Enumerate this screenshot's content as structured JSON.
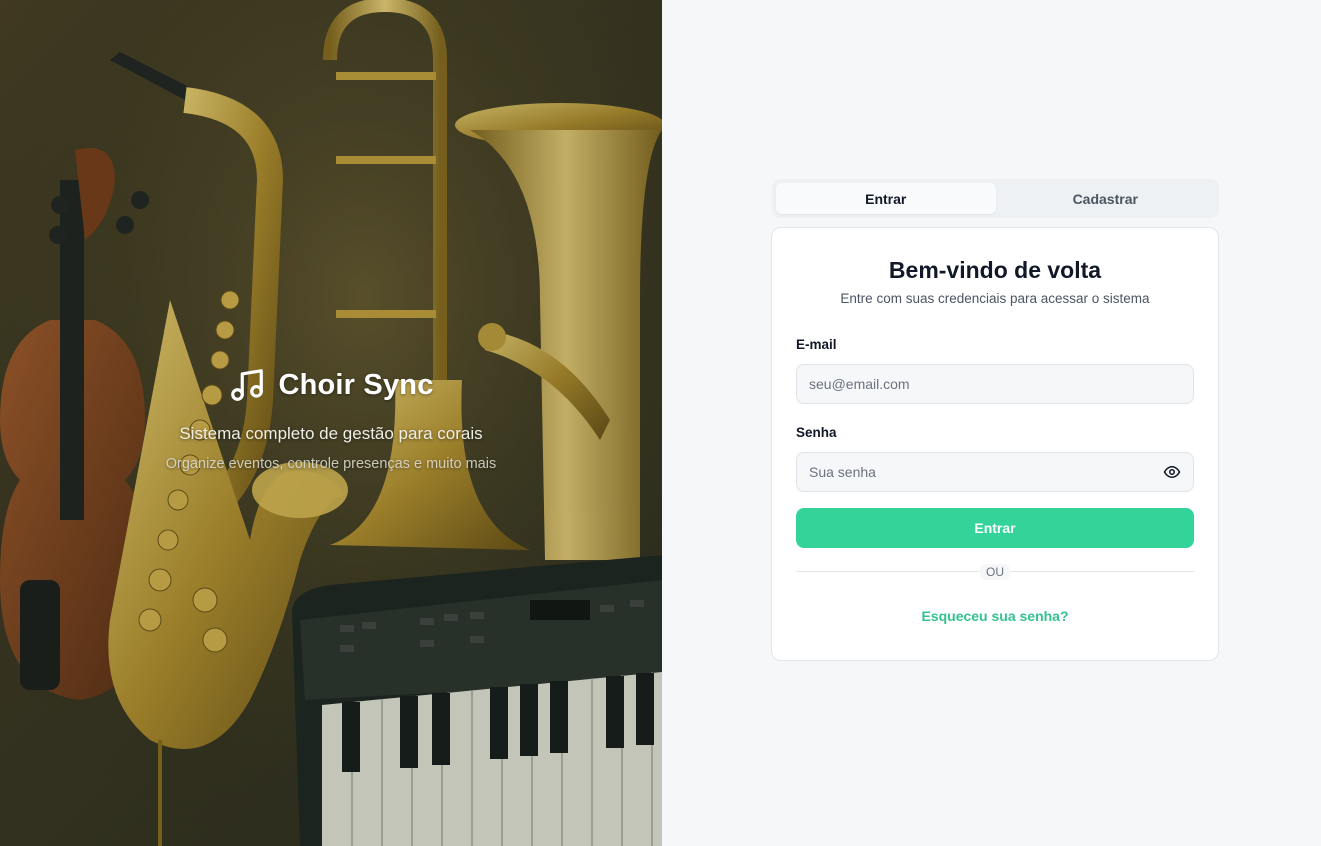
{
  "hero": {
    "brand_name": "Choir Sync",
    "tagline": "Sistema completo de gestão para corais",
    "subtagline": "Organize eventos, controle presenças e muito mais",
    "logo_icon": "music-note-icon"
  },
  "tabs": [
    {
      "label": "Entrar",
      "active": true
    },
    {
      "label": "Cadastrar",
      "active": false
    }
  ],
  "login": {
    "title": "Bem-vindo de volta",
    "subtitle": "Entre com suas credenciais para acessar o sistema",
    "email_label": "E-mail",
    "email_placeholder": "seu@email.com",
    "email_value": "",
    "password_label": "Senha",
    "password_placeholder": "Sua senha",
    "password_value": "",
    "password_toggle_icon": "eye-icon",
    "submit_label": "Entrar",
    "divider_text": "OU",
    "forgot_label": "Esqueceu sua senha?"
  },
  "colors": {
    "accent": "#34d399",
    "link": "#34c38f",
    "page_bg": "#f5f7f9",
    "card_bg": "#ffffff",
    "text": "#111827"
  }
}
